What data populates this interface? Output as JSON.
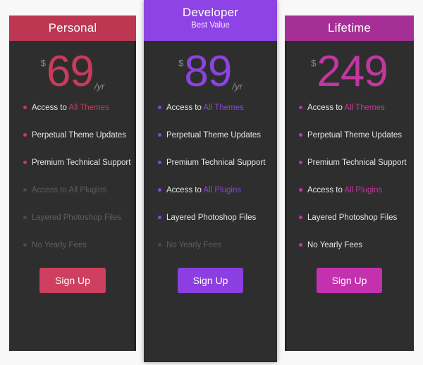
{
  "plans": [
    {
      "id": "personal",
      "name": "Personal",
      "subtitle": "",
      "featured": false,
      "currency": "$",
      "amount": "69",
      "period": "/yr",
      "accent": "#c83b5b",
      "header_bg": "#bd3752",
      "button_bg": "#cf3f5f",
      "button_label": "Sign Up",
      "features": [
        {
          "text": "Access to ",
          "highlight": "All Themes",
          "enabled": true
        },
        {
          "text": "Perpetual Theme Updates",
          "highlight": "",
          "enabled": true
        },
        {
          "text": "Premium Technical Support",
          "highlight": "",
          "enabled": true
        },
        {
          "text": "Access to ",
          "highlight": "All Plugins",
          "enabled": false
        },
        {
          "text": "Layered Photoshop Files",
          "highlight": "",
          "enabled": false
        },
        {
          "text": "No Yearly Fees",
          "highlight": "",
          "enabled": false
        }
      ]
    },
    {
      "id": "developer",
      "name": "Developer",
      "subtitle": "Best Value",
      "featured": true,
      "currency": "$",
      "amount": "89",
      "period": "/yr",
      "accent": "#8b44dd",
      "header_bg": "#8e44e4",
      "button_bg": "#8b3fe0",
      "button_label": "Sign Up",
      "features": [
        {
          "text": "Access to ",
          "highlight": "All Themes",
          "enabled": true
        },
        {
          "text": "Perpetual Theme Updates",
          "highlight": "",
          "enabled": true
        },
        {
          "text": "Premium Technical Support",
          "highlight": "",
          "enabled": true
        },
        {
          "text": "Access to ",
          "highlight": "All Plugins",
          "enabled": true
        },
        {
          "text": "Layered Photoshop Files",
          "highlight": "",
          "enabled": true
        },
        {
          "text": "No Yearly Fees",
          "highlight": "",
          "enabled": false
        }
      ]
    },
    {
      "id": "lifetime",
      "name": "Lifetime",
      "subtitle": "",
      "featured": false,
      "currency": "$",
      "amount": "249",
      "period": "",
      "accent": "#c0389f",
      "header_bg": "#a62f96",
      "button_bg": "#c431af",
      "button_label": "Sign Up",
      "features": [
        {
          "text": "Access to ",
          "highlight": "All Themes",
          "enabled": true
        },
        {
          "text": "Perpetual Theme Updates",
          "highlight": "",
          "enabled": true
        },
        {
          "text": "Premium Technical Support",
          "highlight": "",
          "enabled": true
        },
        {
          "text": "Access to ",
          "highlight": "All Plugins",
          "enabled": true
        },
        {
          "text": "Layered Photoshop Files",
          "highlight": "",
          "enabled": true
        },
        {
          "text": "No Yearly Fees",
          "highlight": "",
          "enabled": true
        }
      ]
    }
  ],
  "theme": {
    "page_bg": "#f8f8f8",
    "card_bg": "#2e2e2e",
    "text_on": "#e6e6e6",
    "text_off": "#5e5e5e",
    "muted": "#8d8d8d"
  }
}
